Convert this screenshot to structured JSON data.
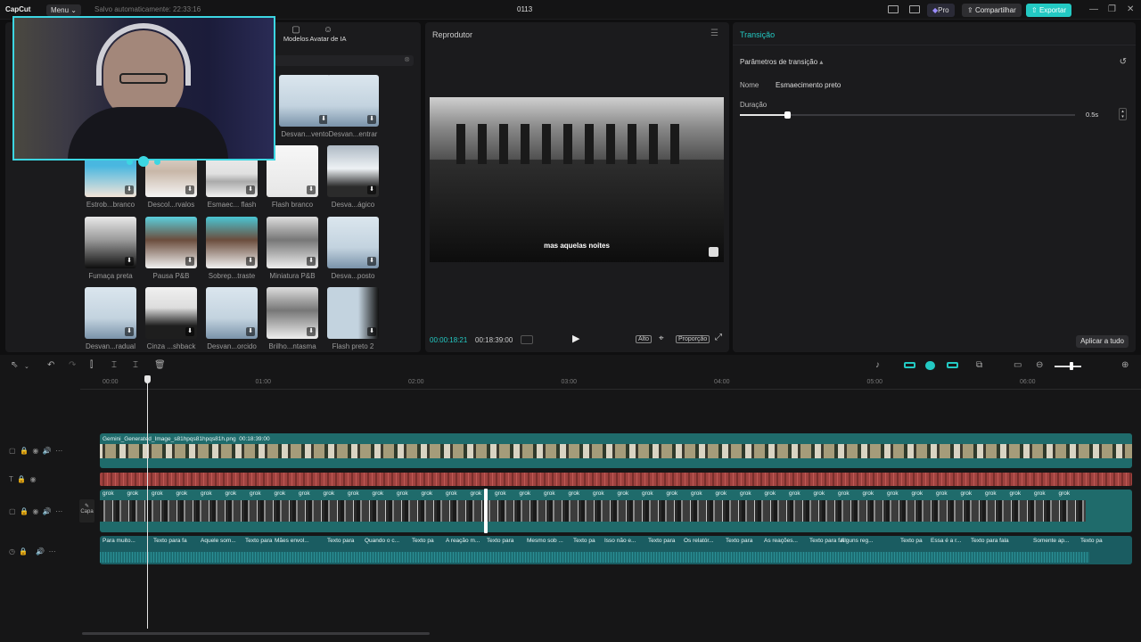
{
  "titlebar": {
    "app_name": "CapCut",
    "menu_label": "Menu",
    "autosave": "Salvo automaticamente: 22:33:16",
    "project_title": "0113",
    "pro_label": "Pro",
    "share_label": "Compartilhar",
    "export_label": "Exportar"
  },
  "media": {
    "tabs": [
      "Modelos",
      "Avatar de IA"
    ],
    "tiles": [
      {
        "label": "Desvan...vento",
        "kind": "tower"
      },
      {
        "label": "Desvan...entrar",
        "kind": "tower"
      },
      {
        "label": "Estrob...branco",
        "kind": "woman"
      },
      {
        "label": "Descol...rvalos",
        "kind": "man"
      },
      {
        "label": "Esmaec... flash",
        "kind": "car"
      },
      {
        "label": "Flash branco",
        "kind": "white"
      },
      {
        "label": "Desva...ágico",
        "kind": "mountain"
      },
      {
        "label": "Fumaça preta",
        "kind": "smoke"
      },
      {
        "label": "Pausa P&B",
        "kind": "man2"
      },
      {
        "label": "Sobrep...traste",
        "kind": "man3"
      },
      {
        "label": "Miniatura P&B",
        "kind": "manbw"
      },
      {
        "label": "Desva...posto",
        "kind": "tower"
      },
      {
        "label": "Desvan...radual",
        "kind": "tower"
      },
      {
        "label": "Cinza ...shback",
        "kind": "mountain2"
      },
      {
        "label": "Desvan...orcido",
        "kind": "tower"
      },
      {
        "label": "Brilho...ntasma",
        "kind": "manbw"
      },
      {
        "label": "Flash preto 2",
        "kind": "towerdark"
      }
    ]
  },
  "player": {
    "title": "Reprodutor",
    "subtitle": "mas aquelas noites",
    "current_time": "00:00:18:21",
    "total_time": "00:18:39:00",
    "quality_label": "Alto",
    "ratio_label": "Proporção"
  },
  "transition": {
    "title": "Transição",
    "section": "Parâmetros de transição",
    "name_label": "Nome",
    "name_value": "Esmaecimento preto",
    "duration_label": "Duração",
    "duration_value": "0.5s",
    "duration_fraction": 0.14,
    "apply_all": "Aplicar a tudo"
  },
  "timeline": {
    "ruler": [
      "00:00",
      "01:00",
      "02:00",
      "03:00",
      "04:00",
      "05:00",
      "06:00"
    ],
    "main_clip_label": "Gemini_Generated_Image_s81hpqs81hpqs81h.png",
    "main_clip_duration": "00:18:39:00",
    "cover_label": "Capa",
    "clip_thumb_label": "grok",
    "captions": [
      "Para muito...",
      "Texto para fa",
      "Aquele som...",
      "Texto para",
      "Mães envol...",
      "Texto para",
      "Quando o c...",
      "Texto pa",
      "A reação m...",
      "Texto para",
      "Mesmo sob ...",
      "Texto pa",
      "Isso não e...",
      "Texto para",
      "Os relatór...",
      "Texto para",
      "As reações...",
      "Texto para fal",
      "Alguns reg...",
      "Texto pa",
      "Essa é a r...",
      "Texto para fala",
      "Somente ap...",
      "Texto pa"
    ],
    "colors": {
      "teal": "#1f6b6b",
      "red": "#a0423f",
      "accent": "#23c9c3"
    }
  }
}
